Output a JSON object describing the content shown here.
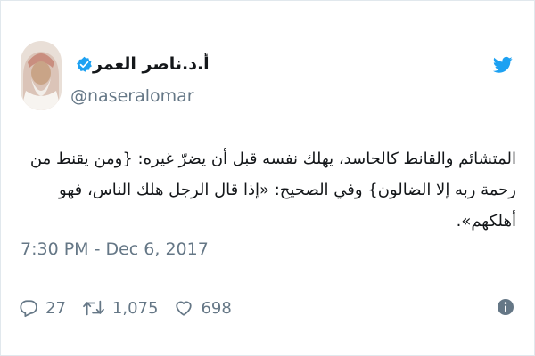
{
  "author": {
    "display_name": "أ.د.ناصر العمر",
    "handle": "@naseralomar",
    "verified_icon": "verified-badge-icon",
    "avatar_icon": "profile-avatar"
  },
  "tweet": {
    "text": "المتشائم والقانط كالحاسد، يهلك نفسه قبل أن يضرّ غيره: {ومن يقنط من رحمة ربه إلا الضالون} وفي الصحيح: «إذا قال الرجل هلك الناس، فهو أهلكهم».",
    "timestamp": "7:30 PM - Dec 6, 2017"
  },
  "actions": {
    "reply_count": "27",
    "retweet_count": "1,075",
    "like_count": "698"
  },
  "colors": {
    "brand": "#1da1f2",
    "text": "#14171a",
    "muted": "#657786"
  }
}
